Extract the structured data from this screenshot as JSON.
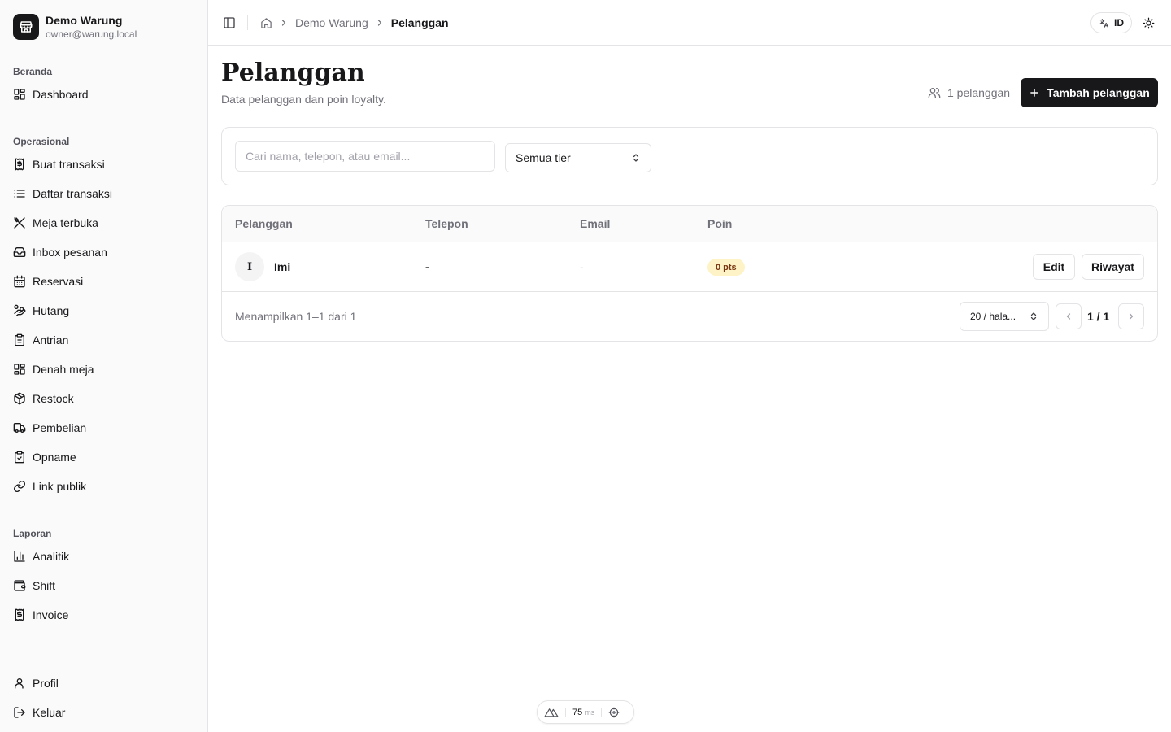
{
  "brand": {
    "name": "Demo Warung",
    "email": "owner@warung.local"
  },
  "sidebar": {
    "groups": [
      {
        "label": "Beranda",
        "items": [
          {
            "label": "Dashboard",
            "icon": "grid-icon"
          }
        ]
      },
      {
        "label": "Operasional",
        "items": [
          {
            "label": "Buat transaksi",
            "icon": "receipt-icon"
          },
          {
            "label": "Daftar transaksi",
            "icon": "list-icon"
          },
          {
            "label": "Meja terbuka",
            "icon": "utensils-icon"
          },
          {
            "label": "Inbox pesanan",
            "icon": "inbox-icon"
          },
          {
            "label": "Reservasi",
            "icon": "calendar-icon"
          },
          {
            "label": "Hutang",
            "icon": "hand-coins-icon"
          },
          {
            "label": "Antrian",
            "icon": "clipboard-icon"
          },
          {
            "label": "Denah meja",
            "icon": "grid-icon"
          },
          {
            "label": "Restock",
            "icon": "package-icon"
          },
          {
            "label": "Pembelian",
            "icon": "truck-icon"
          },
          {
            "label": "Opname",
            "icon": "clipboard-check-icon"
          },
          {
            "label": "Link publik",
            "icon": "link-icon"
          }
        ]
      },
      {
        "label": "Laporan",
        "items": [
          {
            "label": "Analitik",
            "icon": "bar-chart-icon"
          },
          {
            "label": "Shift",
            "icon": "wallet-icon"
          },
          {
            "label": "Invoice",
            "icon": "receipt-icon"
          }
        ]
      }
    ],
    "bottom": [
      {
        "label": "Profil",
        "icon": "user-icon"
      },
      {
        "label": "Keluar",
        "icon": "logout-icon"
      }
    ]
  },
  "header": {
    "breadcrumb": {
      "parent": "Demo Warung",
      "current": "Pelanggan"
    },
    "language": "ID"
  },
  "main": {
    "title": "Pelanggan",
    "subtitle": "Data pelanggan dan poin loyalty.",
    "count_label": "1 pelanggan",
    "add_button": "Tambah pelanggan",
    "search_placeholder": "Cari nama, telepon, atau email...",
    "tier_filter": "Semua tier",
    "table": {
      "columns": [
        "Pelanggan",
        "Telepon",
        "Email",
        "Poin"
      ],
      "rows": [
        {
          "initial": "I",
          "name": "Imi",
          "phone": "-",
          "email": "-",
          "points": "0 pts",
          "actions": [
            "Edit",
            "Riwayat"
          ]
        }
      ]
    },
    "pagination": {
      "summary": "Menampilkan 1–1 dari 1",
      "per_page": "20 / hala...",
      "page": "1 / 1"
    }
  },
  "perf": {
    "value": "75",
    "unit": "ms"
  }
}
